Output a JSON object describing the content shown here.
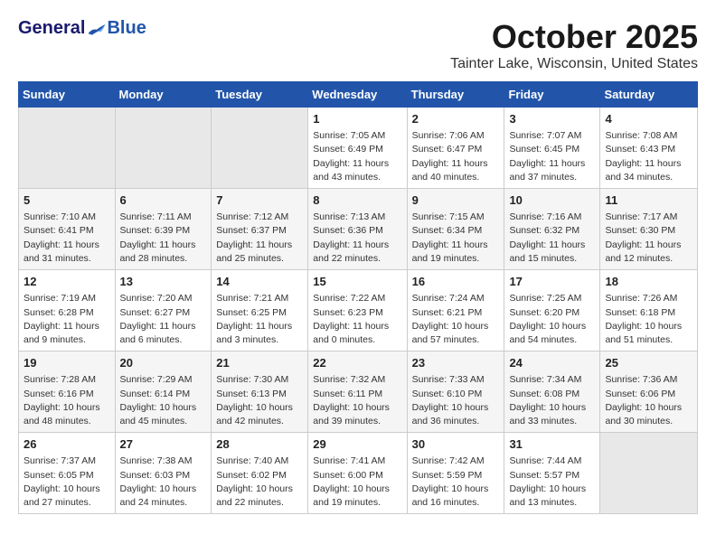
{
  "header": {
    "logo_general": "General",
    "logo_blue": "Blue",
    "month_title": "October 2025",
    "location": "Tainter Lake, Wisconsin, United States"
  },
  "days_of_week": [
    "Sunday",
    "Monday",
    "Tuesday",
    "Wednesday",
    "Thursday",
    "Friday",
    "Saturday"
  ],
  "weeks": [
    [
      {
        "num": "",
        "info": ""
      },
      {
        "num": "",
        "info": ""
      },
      {
        "num": "",
        "info": ""
      },
      {
        "num": "1",
        "info": "Sunrise: 7:05 AM\nSunset: 6:49 PM\nDaylight: 11 hours\nand 43 minutes."
      },
      {
        "num": "2",
        "info": "Sunrise: 7:06 AM\nSunset: 6:47 PM\nDaylight: 11 hours\nand 40 minutes."
      },
      {
        "num": "3",
        "info": "Sunrise: 7:07 AM\nSunset: 6:45 PM\nDaylight: 11 hours\nand 37 minutes."
      },
      {
        "num": "4",
        "info": "Sunrise: 7:08 AM\nSunset: 6:43 PM\nDaylight: 11 hours\nand 34 minutes."
      }
    ],
    [
      {
        "num": "5",
        "info": "Sunrise: 7:10 AM\nSunset: 6:41 PM\nDaylight: 11 hours\nand 31 minutes."
      },
      {
        "num": "6",
        "info": "Sunrise: 7:11 AM\nSunset: 6:39 PM\nDaylight: 11 hours\nand 28 minutes."
      },
      {
        "num": "7",
        "info": "Sunrise: 7:12 AM\nSunset: 6:37 PM\nDaylight: 11 hours\nand 25 minutes."
      },
      {
        "num": "8",
        "info": "Sunrise: 7:13 AM\nSunset: 6:36 PM\nDaylight: 11 hours\nand 22 minutes."
      },
      {
        "num": "9",
        "info": "Sunrise: 7:15 AM\nSunset: 6:34 PM\nDaylight: 11 hours\nand 19 minutes."
      },
      {
        "num": "10",
        "info": "Sunrise: 7:16 AM\nSunset: 6:32 PM\nDaylight: 11 hours\nand 15 minutes."
      },
      {
        "num": "11",
        "info": "Sunrise: 7:17 AM\nSunset: 6:30 PM\nDaylight: 11 hours\nand 12 minutes."
      }
    ],
    [
      {
        "num": "12",
        "info": "Sunrise: 7:19 AM\nSunset: 6:28 PM\nDaylight: 11 hours\nand 9 minutes."
      },
      {
        "num": "13",
        "info": "Sunrise: 7:20 AM\nSunset: 6:27 PM\nDaylight: 11 hours\nand 6 minutes."
      },
      {
        "num": "14",
        "info": "Sunrise: 7:21 AM\nSunset: 6:25 PM\nDaylight: 11 hours\nand 3 minutes."
      },
      {
        "num": "15",
        "info": "Sunrise: 7:22 AM\nSunset: 6:23 PM\nDaylight: 11 hours\nand 0 minutes."
      },
      {
        "num": "16",
        "info": "Sunrise: 7:24 AM\nSunset: 6:21 PM\nDaylight: 10 hours\nand 57 minutes."
      },
      {
        "num": "17",
        "info": "Sunrise: 7:25 AM\nSunset: 6:20 PM\nDaylight: 10 hours\nand 54 minutes."
      },
      {
        "num": "18",
        "info": "Sunrise: 7:26 AM\nSunset: 6:18 PM\nDaylight: 10 hours\nand 51 minutes."
      }
    ],
    [
      {
        "num": "19",
        "info": "Sunrise: 7:28 AM\nSunset: 6:16 PM\nDaylight: 10 hours\nand 48 minutes."
      },
      {
        "num": "20",
        "info": "Sunrise: 7:29 AM\nSunset: 6:14 PM\nDaylight: 10 hours\nand 45 minutes."
      },
      {
        "num": "21",
        "info": "Sunrise: 7:30 AM\nSunset: 6:13 PM\nDaylight: 10 hours\nand 42 minutes."
      },
      {
        "num": "22",
        "info": "Sunrise: 7:32 AM\nSunset: 6:11 PM\nDaylight: 10 hours\nand 39 minutes."
      },
      {
        "num": "23",
        "info": "Sunrise: 7:33 AM\nSunset: 6:10 PM\nDaylight: 10 hours\nand 36 minutes."
      },
      {
        "num": "24",
        "info": "Sunrise: 7:34 AM\nSunset: 6:08 PM\nDaylight: 10 hours\nand 33 minutes."
      },
      {
        "num": "25",
        "info": "Sunrise: 7:36 AM\nSunset: 6:06 PM\nDaylight: 10 hours\nand 30 minutes."
      }
    ],
    [
      {
        "num": "26",
        "info": "Sunrise: 7:37 AM\nSunset: 6:05 PM\nDaylight: 10 hours\nand 27 minutes."
      },
      {
        "num": "27",
        "info": "Sunrise: 7:38 AM\nSunset: 6:03 PM\nDaylight: 10 hours\nand 24 minutes."
      },
      {
        "num": "28",
        "info": "Sunrise: 7:40 AM\nSunset: 6:02 PM\nDaylight: 10 hours\nand 22 minutes."
      },
      {
        "num": "29",
        "info": "Sunrise: 7:41 AM\nSunset: 6:00 PM\nDaylight: 10 hours\nand 19 minutes."
      },
      {
        "num": "30",
        "info": "Sunrise: 7:42 AM\nSunset: 5:59 PM\nDaylight: 10 hours\nand 16 minutes."
      },
      {
        "num": "31",
        "info": "Sunrise: 7:44 AM\nSunset: 5:57 PM\nDaylight: 10 hours\nand 13 minutes."
      },
      {
        "num": "",
        "info": ""
      }
    ]
  ]
}
